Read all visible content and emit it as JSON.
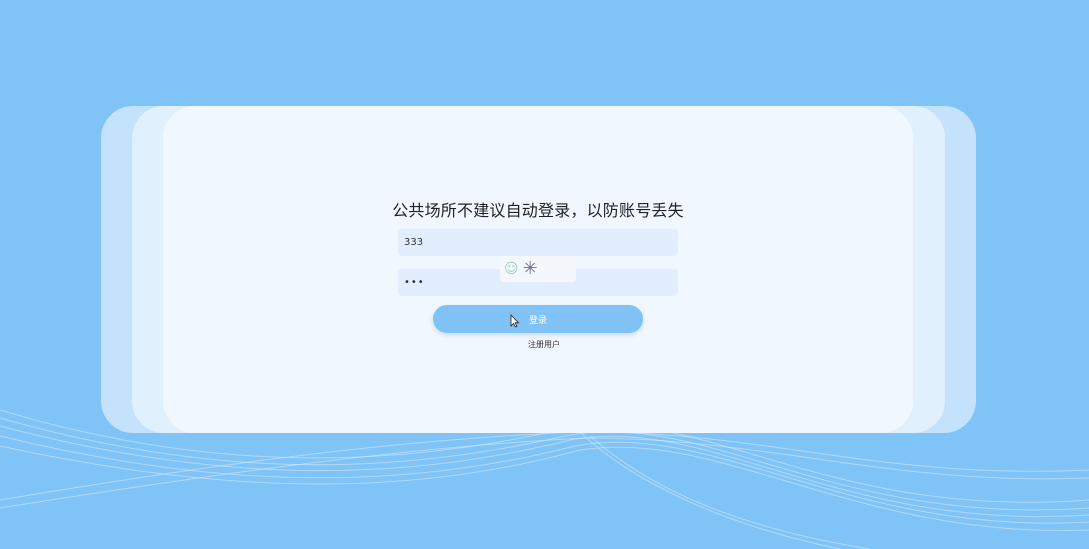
{
  "login": {
    "title": "公共场所不建议自动登录，以防账号丢失",
    "username_value": "333",
    "password_value": "•••",
    "submit_label": "登录",
    "register_link": "注册用户"
  },
  "captcha": {
    "icons": [
      "smile-icon",
      "loading-spinner-icon"
    ]
  },
  "colors": {
    "background": "#7fc3f7",
    "card": "#f0f7ff",
    "input": "#e2eefd",
    "button": "#80c2f5"
  }
}
